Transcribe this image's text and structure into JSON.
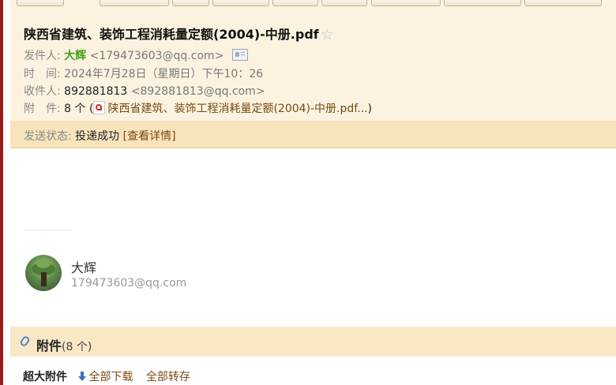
{
  "mail": {
    "subject": "陕西省建筑、装饰工程消耗量定额(2004)-中册.pdf",
    "star_icon": "star-outline-icon",
    "sender_label": "发件人:",
    "sender_name": "大辉",
    "sender_email": "<179473603@qq.com>",
    "time_label": "时　间:",
    "time_value": "2024年7月28日（星期日）下午10：26",
    "recipient_label": "收件人:",
    "recipient_name": "892881813",
    "recipient_email": "<892881813@qq.com>",
    "attachment_label": "附　件:",
    "attachment_count": "8 个",
    "attachment_open": "(",
    "attachment_preview": "陕西省建筑、装饰工程消耗量定额(2004)-中册.pdf...",
    "attachment_close": ")"
  },
  "status": {
    "label": "发送状态:",
    "value": "投递成功",
    "detail_link": "[查看详情]"
  },
  "signature": {
    "name": "大辉",
    "email": "179473603@qq.com"
  },
  "attachments": {
    "title": "附件",
    "count": "(8 个)",
    "big_label": "超大附件",
    "download_all": "全部下载",
    "save_all": "全部转存"
  }
}
